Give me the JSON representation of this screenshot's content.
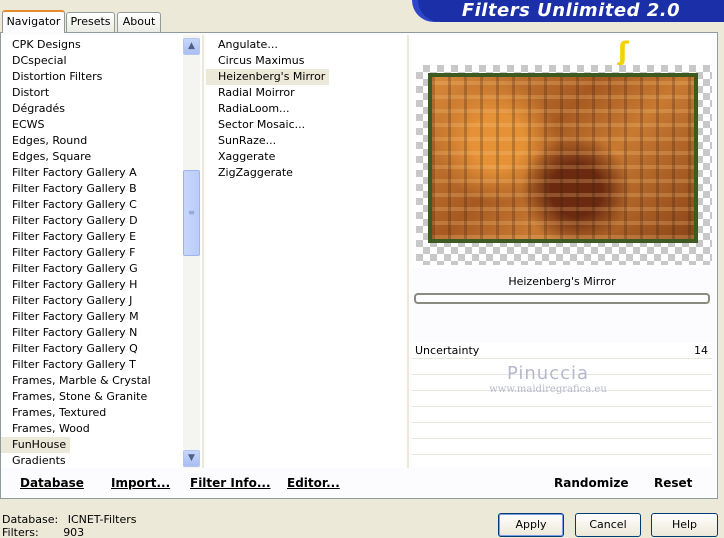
{
  "tabs": [
    "Navigator",
    "Presets",
    "About"
  ],
  "app_title": "Filters Unlimited 2.0",
  "categories": [
    "CPK Designs",
    "DCspecial",
    "Distortion Filters",
    "Distort",
    "Dégradés",
    "ECWS",
    "Edges, Round",
    "Edges, Square",
    "Filter Factory Gallery A",
    "Filter Factory Gallery B",
    "Filter Factory Gallery C",
    "Filter Factory Gallery D",
    "Filter Factory Gallery E",
    "Filter Factory Gallery F",
    "Filter Factory Gallery G",
    "Filter Factory Gallery H",
    "Filter Factory Gallery J",
    "Filter Factory Gallery M",
    "Filter Factory Gallery N",
    "Filter Factory Gallery Q",
    "Filter Factory Gallery T",
    "Frames, Marble & Crystal",
    "Frames, Stone & Granite",
    "Frames, Textured",
    "Frames, Wood",
    "FunHouse",
    "Gradients"
  ],
  "selected_category": "FunHouse",
  "filters": [
    "Angulate...",
    "Circus Maximus",
    "Heizenberg's Mirror",
    "Radial Moirror",
    "RadiaLoom...",
    "Sector Mosaic...",
    "SunRaze...",
    "Xaggerate",
    "ZigZaggerate"
  ],
  "selected_filter": "Heizenberg's Mirror",
  "preview": {
    "filter_name": "Heizenberg's Mirror",
    "hand_icon": "pointing-hand-icon"
  },
  "params": [
    {
      "name": "Uncertainty",
      "value": "14"
    }
  ],
  "watermark": {
    "line1": "Pinuccia",
    "line2": "www.maidiregrafica.eu"
  },
  "toolbar": {
    "database": "Database",
    "import": "Import...",
    "filter_info": "Filter Info...",
    "editor": "Editor...",
    "randomize": "Randomize",
    "reset": "Reset"
  },
  "status": {
    "database_label": "Database:",
    "database_value": "ICNET-Filters",
    "filters_label": "Filters:",
    "filters_value": "903"
  },
  "buttons": {
    "apply": "Apply",
    "cancel": "Cancel",
    "help": "Help"
  }
}
